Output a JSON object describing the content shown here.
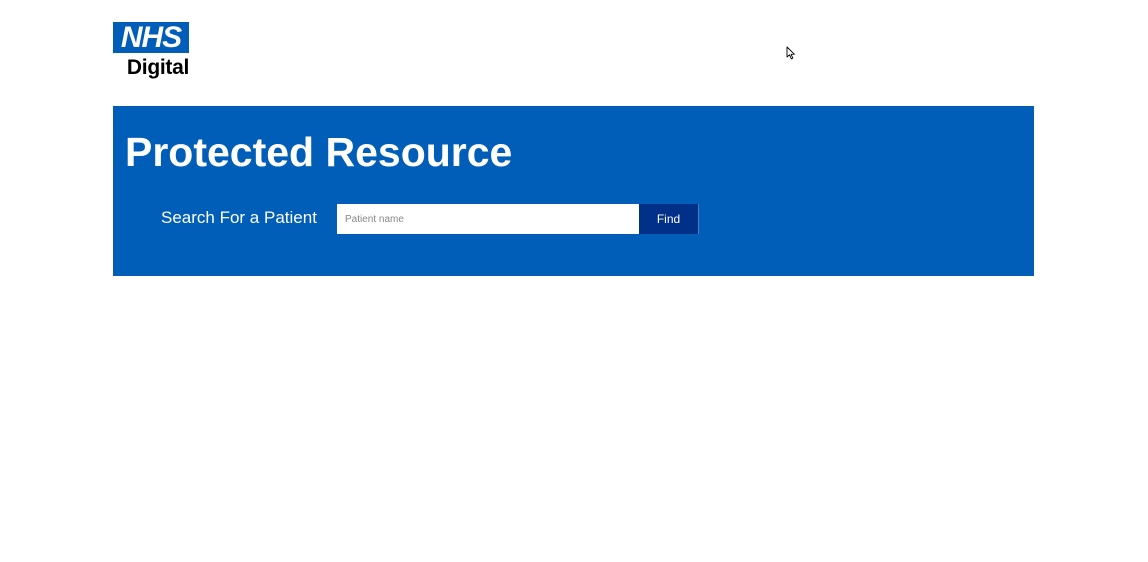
{
  "header": {
    "logo_text": "NHS",
    "logo_subtext": "Digital"
  },
  "banner": {
    "title": "Protected Resource",
    "search_label": "Search For a Patient",
    "search_placeholder": "Patient name",
    "find_label": "Find"
  },
  "colors": {
    "brand_blue": "#005eb8",
    "button_dark_blue": "#003087",
    "text_white": "#ffffff"
  },
  "icons": {
    "cursor": "mouse-pointer-icon"
  }
}
